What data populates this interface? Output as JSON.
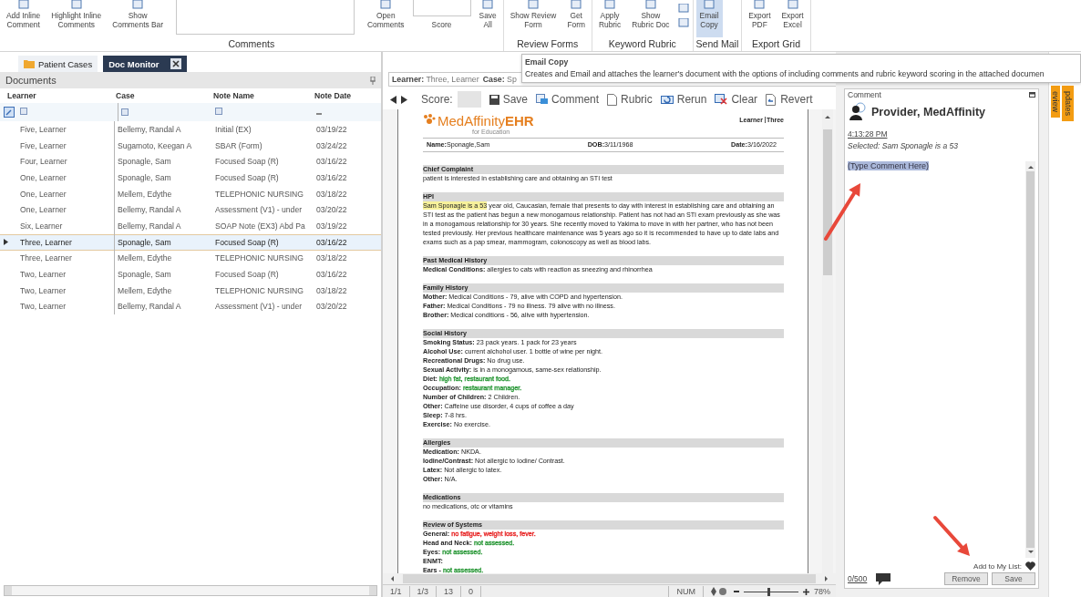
{
  "ribbon": {
    "groups": [
      {
        "label": "Comments",
        "items": [
          {
            "kind": "button",
            "label": "Add Inline\nComment",
            "hovered": false
          },
          {
            "kind": "button",
            "label": "Highlight Inline\nComments",
            "hovered": false
          },
          {
            "kind": "button",
            "label": "Show\nComments Bar",
            "hovered": false
          },
          {
            "kind": "field",
            "hovered": false
          },
          {
            "kind": "button",
            "label": "Open\nComments",
            "hovered": false
          },
          {
            "kind": "score",
            "label": "Score",
            "hovered": false
          },
          {
            "kind": "button",
            "label": "Save\nAll",
            "hovered": false
          }
        ]
      },
      {
        "label": "Review Forms",
        "items": [
          {
            "kind": "button",
            "label": "Show Review\nForm",
            "hovered": false
          },
          {
            "kind": "button",
            "label": "Get\nForm",
            "hovered": false
          }
        ]
      },
      {
        "label": "Keyword Rubric",
        "items": [
          {
            "kind": "button",
            "label": "Apply\nRubric",
            "hovered": false
          },
          {
            "kind": "button",
            "label": "Show\nRubric Doc",
            "hovered": false
          },
          {
            "kind": "icon-stack",
            "hovered": false
          }
        ]
      },
      {
        "label": "Send Mail",
        "items": [
          {
            "kind": "button",
            "label": "Email\nCopy",
            "hovered": true
          }
        ]
      },
      {
        "label": "Export Grid",
        "items": [
          {
            "kind": "button",
            "label": "Export\nPDF",
            "hovered": false
          },
          {
            "kind": "button",
            "label": "Export\nExcel",
            "hovered": false
          }
        ]
      }
    ]
  },
  "left_tabs": [
    {
      "label": "Patient Cases",
      "kind": "folder",
      "selected": false
    },
    {
      "label": "Doc Monitor",
      "kind": "closable",
      "selected": true
    }
  ],
  "documents": {
    "title": "Documents",
    "columns": [
      "Learner",
      "Case",
      "Note Name",
      "Note Date"
    ],
    "rows": [
      {
        "cells": [
          "Five, Learner",
          "Bellemy, Randal A",
          "Initial (EX)",
          "03/19/22"
        ],
        "selected": false
      },
      {
        "cells": [
          "Five, Learner",
          "Sugamoto, Keegan A",
          "SBAR (Form)",
          "03/24/22"
        ],
        "selected": false
      },
      {
        "cells": [
          "Four, Learner",
          "Sponagle, Sam",
          "Focused Soap (R)",
          "03/16/22"
        ],
        "selected": false
      },
      {
        "cells": [
          "One, Learner",
          "Sponagle, Sam",
          "Focused Soap (R)",
          "03/16/22"
        ],
        "selected": false
      },
      {
        "cells": [
          "One, Learner",
          "Mellem, Edythe",
          "TELEPHONIC NURSING",
          "03/18/22"
        ],
        "selected": false
      },
      {
        "cells": [
          "One, Learner",
          "Bellemy, Randal A",
          "Assessment (V1) - under",
          "03/20/22"
        ],
        "selected": false
      },
      {
        "cells": [
          "Six, Learner",
          "Bellemy, Randal A",
          "SOAP Note (EX3) Abd Pa",
          "03/19/22"
        ],
        "selected": false
      },
      {
        "cells": [
          "Three, Learner",
          "Sponagle, Sam",
          "Focused Soap (R)",
          "03/16/22"
        ],
        "selected": true
      },
      {
        "cells": [
          "Three, Learner",
          "Mellem, Edythe",
          "TELEPHONIC NURSING",
          "03/18/22"
        ],
        "selected": false
      },
      {
        "cells": [
          "Two, Learner",
          "Sponagle, Sam",
          "Focused Soap (R)",
          "03/16/22"
        ],
        "selected": false
      },
      {
        "cells": [
          "Two, Learner",
          "Mellem, Edythe",
          "TELEPHONIC NURSING",
          "03/18/22"
        ],
        "selected": false
      },
      {
        "cells": [
          "Two, Learner",
          "Bellemy, Randal A",
          "Assessment (V1) - under",
          "03/20/22"
        ],
        "selected": false
      }
    ]
  },
  "learner_bar": [
    {
      "label": "Learner:",
      "value": "Three, Learner"
    },
    {
      "label": "Case:",
      "value": "Sp"
    }
  ],
  "toolbar": {
    "score_label": "Score:",
    "buttons": [
      {
        "kind": "save",
        "label": "Save"
      },
      {
        "kind": "comment",
        "label": "Comment"
      },
      {
        "kind": "rubric",
        "label": "Rubric"
      },
      {
        "kind": "rerun",
        "label": "Rerun"
      },
      {
        "kind": "clear",
        "label": "Clear"
      },
      {
        "kind": "revert",
        "label": "Revert"
      }
    ]
  },
  "document": {
    "logo": {
      "name": "MedAffinity",
      "suffix": "EHR",
      "tagline": "for Education"
    },
    "learner_tag": {
      "label": "Learner",
      "value": "Three"
    },
    "patient": [
      {
        "label": "Name:",
        "value": "Sponagle,Sam"
      },
      {
        "label": "DOB:",
        "value": "3/11/1968"
      },
      {
        "label": "Date:",
        "value": "3/16/2022"
      }
    ],
    "sections": [
      {
        "title": "Chief Complaint",
        "lines": [
          {
            "text": "patient is interested in establishing care and obtaining an STI test"
          }
        ]
      },
      {
        "title": "HPI",
        "lines": [
          {
            "highlight": "Sam Sponagle is a 53",
            "text": " year old, Caucasian, female that presents to day with interest in establishing care and obtaining an STI test as the patient has begun a new monogamous relationship. Patient has not had an STI exam previously as she was in a monogamous relationship for 30 years. She recently moved to Yakima to move in with her partner, who has not been tested previously. Her previous healthcare maintenance was 5 years ago so it is recommended to have up to date labs and exams such as a pap smear, mammogram, colonoscopy as well as blood labs."
          }
        ]
      },
      {
        "title": "Past Medical History",
        "lines": [
          {
            "label": "Medical Conditions:",
            "text": "allergies to cats with reaction as sneezing and rhinorrhea"
          }
        ]
      },
      {
        "title": "Family History",
        "lines": [
          {
            "label": "Mother:",
            "text": "Medical Conditions - 79, alive with COPD and hypertension."
          },
          {
            "label": "Father:",
            "text": "Medical Conditions - 79 no illness. 79 alive with no illness."
          },
          {
            "label": "Brother:",
            "text": "Medical conditions - 56, alive with hypertension."
          }
        ]
      },
      {
        "title": "Social History",
        "lines": [
          {
            "label": "Smoking Status:",
            "text": "23 pack years. 1 pack for 23 years"
          },
          {
            "label": "Alcohol Use:",
            "text": "current alchohol user. 1 bottle of wine per night."
          },
          {
            "label": "Recreational Drugs:",
            "text": "No drug use."
          },
          {
            "label": "Sexual Activity:",
            "text": "is in a monogamous, same-sex relationship."
          },
          {
            "label": "Diet:",
            "text": "high fat, restaurant food.",
            "color": "#2e9a3c"
          },
          {
            "label": "Occupation:",
            "text": "restaurant manager.",
            "color": "#2e9a3c"
          },
          {
            "label": "Number of Children:",
            "text": "2 Children."
          },
          {
            "label": "Other:",
            "text": "Caffeine use disorder, 4 cups of coffee a day"
          },
          {
            "label": "Sleep:",
            "text": "7-8 hrs."
          },
          {
            "label": "Exercise:",
            "text": "No exercise."
          }
        ]
      },
      {
        "title": "Allergies",
        "lines": [
          {
            "label": "Medication:",
            "text": "NKDA."
          },
          {
            "label": "Iodine/Contrast:",
            "text": "Not allergic to Iodine/ Contrast."
          },
          {
            "label": "Latex:",
            "text": "Not allergic to latex."
          },
          {
            "label": "Other:",
            "text": "N/A."
          }
        ]
      },
      {
        "title": "Medications",
        "lines": [
          {
            "text": "no medications, otc or vitamins"
          }
        ]
      },
      {
        "title": "Review of Systems",
        "lines": [
          {
            "label": "General:",
            "text": "no fatigue, weight loss, fever.",
            "color": "#e82a2a"
          },
          {
            "label": "Head and Neck:",
            "text": "not assessed.",
            "color": "#2e9a3c"
          },
          {
            "label": "Eyes:",
            "text": "not assessed.",
            "color": "#2e9a3c"
          },
          {
            "label": "ENMT:"
          },
          {
            "label": "Ears -",
            "text": "not assessed.",
            "color": "#2e9a3c"
          }
        ]
      }
    ]
  },
  "status_bar": {
    "cells": [
      "1/1",
      "1/3",
      "13",
      "0"
    ],
    "mode": "NUM",
    "zoom": {
      "level": 0.45,
      "reading": "78%"
    }
  },
  "comment_panel": {
    "title": "Comment",
    "author": "Provider, MedAffinity",
    "time": "4:13:28 PM",
    "selection": "Selected: Sam Sponagle is a 53",
    "comment": "(Type Comment Here)",
    "add_to_list": "Add to My List:",
    "counter": "0/500",
    "buttons": [
      "Remove",
      "Save"
    ]
  },
  "side_tabs": [
    "eview",
    "pdates"
  ],
  "tooltip": {
    "title": "Email Copy",
    "text": "Creates and Email and attaches the learner's document with the options of including comments and rubric keyword scoring in the attached documen"
  }
}
